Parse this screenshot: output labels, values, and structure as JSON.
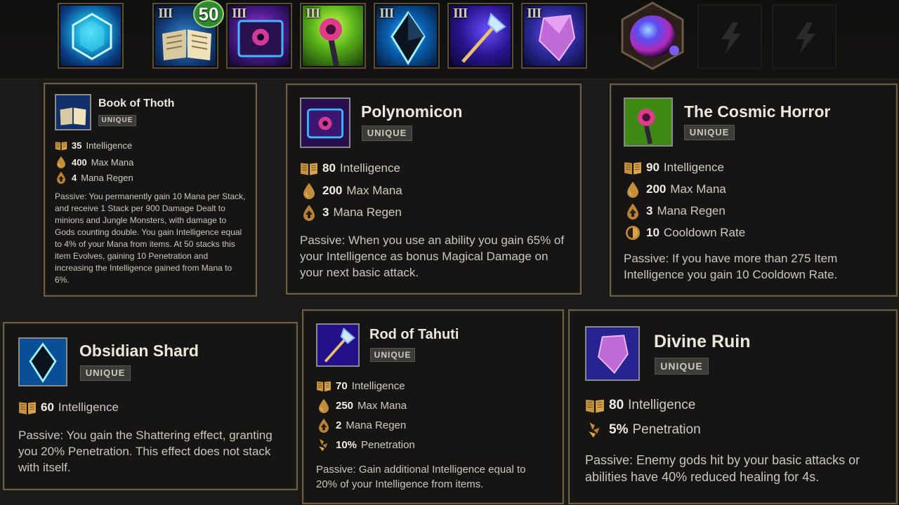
{
  "build": {
    "level_badge": "50",
    "tiers": [
      "III",
      "III",
      "III",
      "III",
      "III",
      "III"
    ],
    "slot_icons": [
      "starter-gem-icon",
      "book-of-thoth-icon",
      "polynomicon-icon",
      "cosmic-horror-icon",
      "obsidian-shard-icon",
      "rod-of-tahuti-icon",
      "divine-ruin-icon",
      "relic-orb-icon",
      "empty-slot-lightning-icon",
      "empty-slot-lightning-icon"
    ]
  },
  "cards": {
    "thoth": {
      "name": "Book of Thoth",
      "badge": "UNIQUE",
      "stats": [
        {
          "value": "35",
          "label": "Intelligence"
        },
        {
          "value": "400",
          "label": "Max Mana"
        },
        {
          "value": "4",
          "label": "Mana Regen"
        }
      ],
      "passive": "Passive: You permanently gain 10 Mana per Stack, and receive 1 Stack per 900 Damage Dealt to minions and Jungle Monsters, with damage to Gods counting double. You gain Intelligence equal to 4% of your Mana from items. At 50 stacks this item Evolves, gaining 10 Penetration and increasing the Intelligence gained from Mana to 6%."
    },
    "poly": {
      "name": "Polynomicon",
      "badge": "UNIQUE",
      "stats": [
        {
          "value": "80",
          "label": "Intelligence"
        },
        {
          "value": "200",
          "label": "Max Mana"
        },
        {
          "value": "3",
          "label": "Mana Regen"
        }
      ],
      "passive": "Passive: When you use an ability you gain 65% of your Intelligence as bonus Magical Damage on your next basic attack."
    },
    "cosmic": {
      "name": "The Cosmic Horror",
      "badge": "UNIQUE",
      "stats": [
        {
          "value": "90",
          "label": "Intelligence"
        },
        {
          "value": "200",
          "label": "Max Mana"
        },
        {
          "value": "3",
          "label": "Mana Regen"
        },
        {
          "value": "10",
          "label": "Cooldown Rate"
        }
      ],
      "passive": "Passive: If you have more than 275 Item Intelligence you gain 10 Cooldown Rate."
    },
    "obsidian": {
      "name": "Obsidian Shard",
      "badge": "UNIQUE",
      "stats": [
        {
          "value": "60",
          "label": "Intelligence"
        }
      ],
      "passive": "Passive: You gain the Shattering effect, granting you 20% Penetration. This effect does not stack with itself."
    },
    "rod": {
      "name": "Rod of Tahuti",
      "badge": "UNIQUE",
      "stats": [
        {
          "value": "70",
          "label": "Intelligence"
        },
        {
          "value": "250",
          "label": "Max Mana"
        },
        {
          "value": "2",
          "label": "Mana Regen"
        },
        {
          "value": "10%",
          "label": "Penetration"
        }
      ],
      "passive": "Passive: Gain additional Intelligence equal to 20% of your Intelligence from items."
    },
    "ruin": {
      "name": "Divine Ruin",
      "badge": "UNIQUE",
      "stats": [
        {
          "value": "80",
          "label": "Intelligence"
        },
        {
          "value": "5%",
          "label": "Penetration"
        }
      ],
      "passive": "Passive: Enemy gods hit by your basic attacks or abilities have 40% reduced healing for 4s."
    }
  }
}
